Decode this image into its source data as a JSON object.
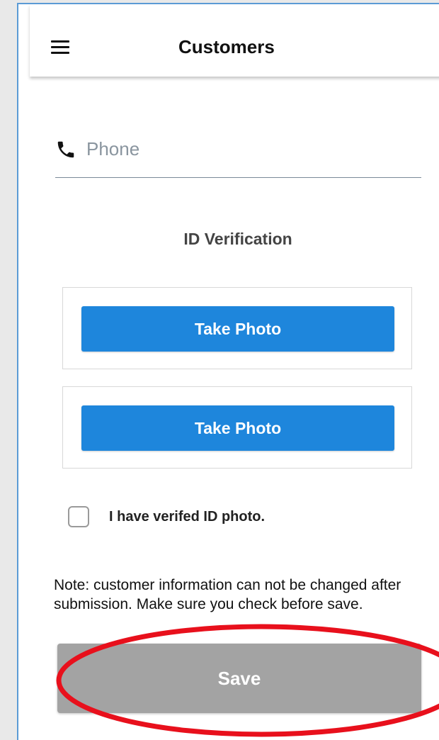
{
  "header": {
    "title": "Customers",
    "menu_icon": "hamburger-menu-icon"
  },
  "phone": {
    "icon": "phone-icon",
    "placeholder": "Phone",
    "value": ""
  },
  "id_verification": {
    "title": "ID Verification",
    "cards": [
      {
        "button_label": "Take Photo"
      },
      {
        "button_label": "Take Photo"
      }
    ]
  },
  "verify_checkbox": {
    "label": "I have verifed ID photo.",
    "checked": false
  },
  "note": "Note: customer information can not be changed after submission. Make sure you check before save.",
  "save": {
    "label": "Save",
    "enabled": false
  },
  "colors": {
    "primary_button": "#1e86dc",
    "disabled_button": "#a3a3a3",
    "highlight_annotation": "#e8101c",
    "frame_border": "#5b9bd5"
  }
}
